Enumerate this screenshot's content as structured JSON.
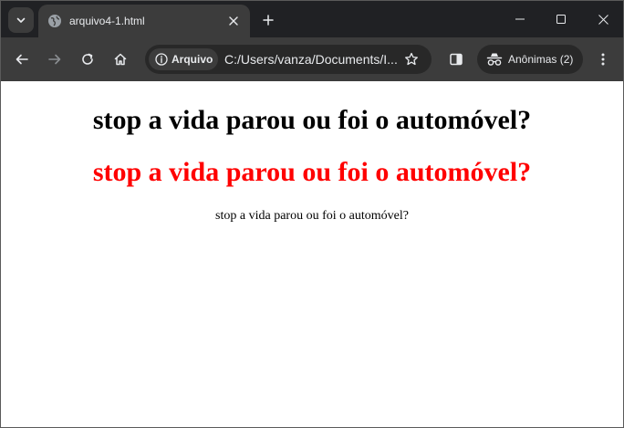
{
  "browser": {
    "tab": {
      "title": "arquivo4-1.html"
    },
    "address_bar": {
      "chip_label": "Arquivo",
      "url": "C:/Users/vanza/Documents/I..."
    },
    "profile": {
      "label": "Anônimas (2)"
    },
    "icons": {
      "tab_search": "chevron-down-icon",
      "favicon": "globe-icon",
      "tab_close": "close-icon",
      "new_tab": "plus-icon",
      "back": "arrow-left-icon",
      "forward": "arrow-right-icon",
      "reload": "reload-icon",
      "home": "home-icon",
      "info": "info-icon",
      "bookmark": "star-icon",
      "side_panel": "side-panel-icon",
      "incognito": "incognito-icon",
      "menu": "kebab-menu-icon",
      "minimize": "minimize-icon",
      "maximize": "maximize-icon",
      "close_window": "close-icon"
    }
  },
  "page": {
    "heading1": "stop a vida parou ou foi o automóvel?",
    "heading2": "stop a vida parou ou foi o automóvel?",
    "paragraph": "stop a vida parou ou foi o automóvel?"
  },
  "colors": {
    "heading2": "#ff0000",
    "chrome_dark": "#202124",
    "toolbar": "#3c3c3c"
  }
}
